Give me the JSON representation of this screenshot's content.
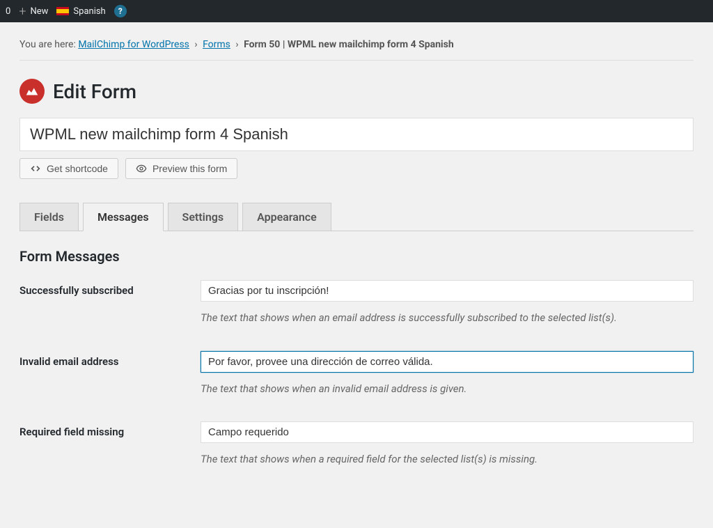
{
  "admin_bar": {
    "count": "0",
    "new_label": "New",
    "language_label": "Spanish"
  },
  "breadcrumb": {
    "prefix": "You are here:",
    "link1": "MailChimp for WordPress",
    "link2": "Forms",
    "current": "Form 50 | WPML new mailchimp form 4 Spanish"
  },
  "page_title": "Edit Form",
  "form_title_value": "WPML new mailchimp form 4 Spanish",
  "toolbar": {
    "shortcode_label": "Get shortcode",
    "preview_label": "Preview this form"
  },
  "tabs": {
    "fields": "Fields",
    "messages": "Messages",
    "settings": "Settings",
    "appearance": "Appearance"
  },
  "section_title": "Form Messages",
  "messages": {
    "subscribed": {
      "label": "Successfully subscribed",
      "value": "Gracias por tu inscripción!",
      "help": "The text that shows when an email address is successfully subscribed to the selected list(s)."
    },
    "invalid_email": {
      "label": "Invalid email address",
      "value": "Por favor, provee una dirección de correo válida.",
      "help": "The text that shows when an invalid email address is given."
    },
    "required_missing": {
      "label": "Required field missing",
      "value": "Campo requerido",
      "help": "The text that shows when a required field for the selected list(s) is missing."
    }
  }
}
